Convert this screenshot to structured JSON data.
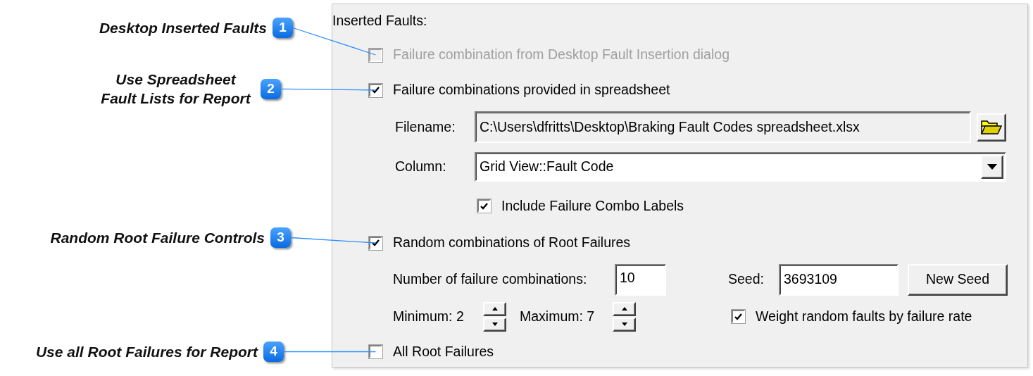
{
  "callouts": [
    {
      "number": "1",
      "label": "Desktop Inserted Faults"
    },
    {
      "number": "2",
      "label": "Use Spreadsheet Fault Lists for Report"
    },
    {
      "number": "3",
      "label": "Random Root Failure Controls"
    },
    {
      "number": "4",
      "label": "Use all Root Failures for Report"
    }
  ],
  "panel": {
    "title": "Inserted Faults:",
    "desktop_option": {
      "label": "Failure combination from Desktop Fault Insertion dialog",
      "checked": false,
      "disabled": true
    },
    "spreadsheet_option": {
      "label": "Failure combinations provided in spreadsheet",
      "checked": true,
      "disabled": false
    },
    "filename": {
      "label": "Filename:",
      "value": "C:\\Users\\dfritts\\Desktop\\Braking Fault Codes spreadsheet.xlsx"
    },
    "column": {
      "label": "Column:",
      "value": "Grid View::Fault Code"
    },
    "include_labels": {
      "label": "Include Failure Combo Labels",
      "checked": true
    },
    "random_option": {
      "label": "Random combinations of Root Failures",
      "checked": true,
      "disabled": false
    },
    "count": {
      "label": "Number of failure combinations:",
      "value": "10"
    },
    "seed": {
      "label": "Seed:",
      "value": "3693109"
    },
    "new_seed_button": "New Seed",
    "minimum": "Minimum: 2",
    "maximum": "Maximum: 7",
    "weight_option": {
      "label": "Weight random faults by failure rate",
      "checked": true
    },
    "all_roots_option": {
      "label": "All Root Failures",
      "checked": false,
      "disabled": false
    }
  }
}
